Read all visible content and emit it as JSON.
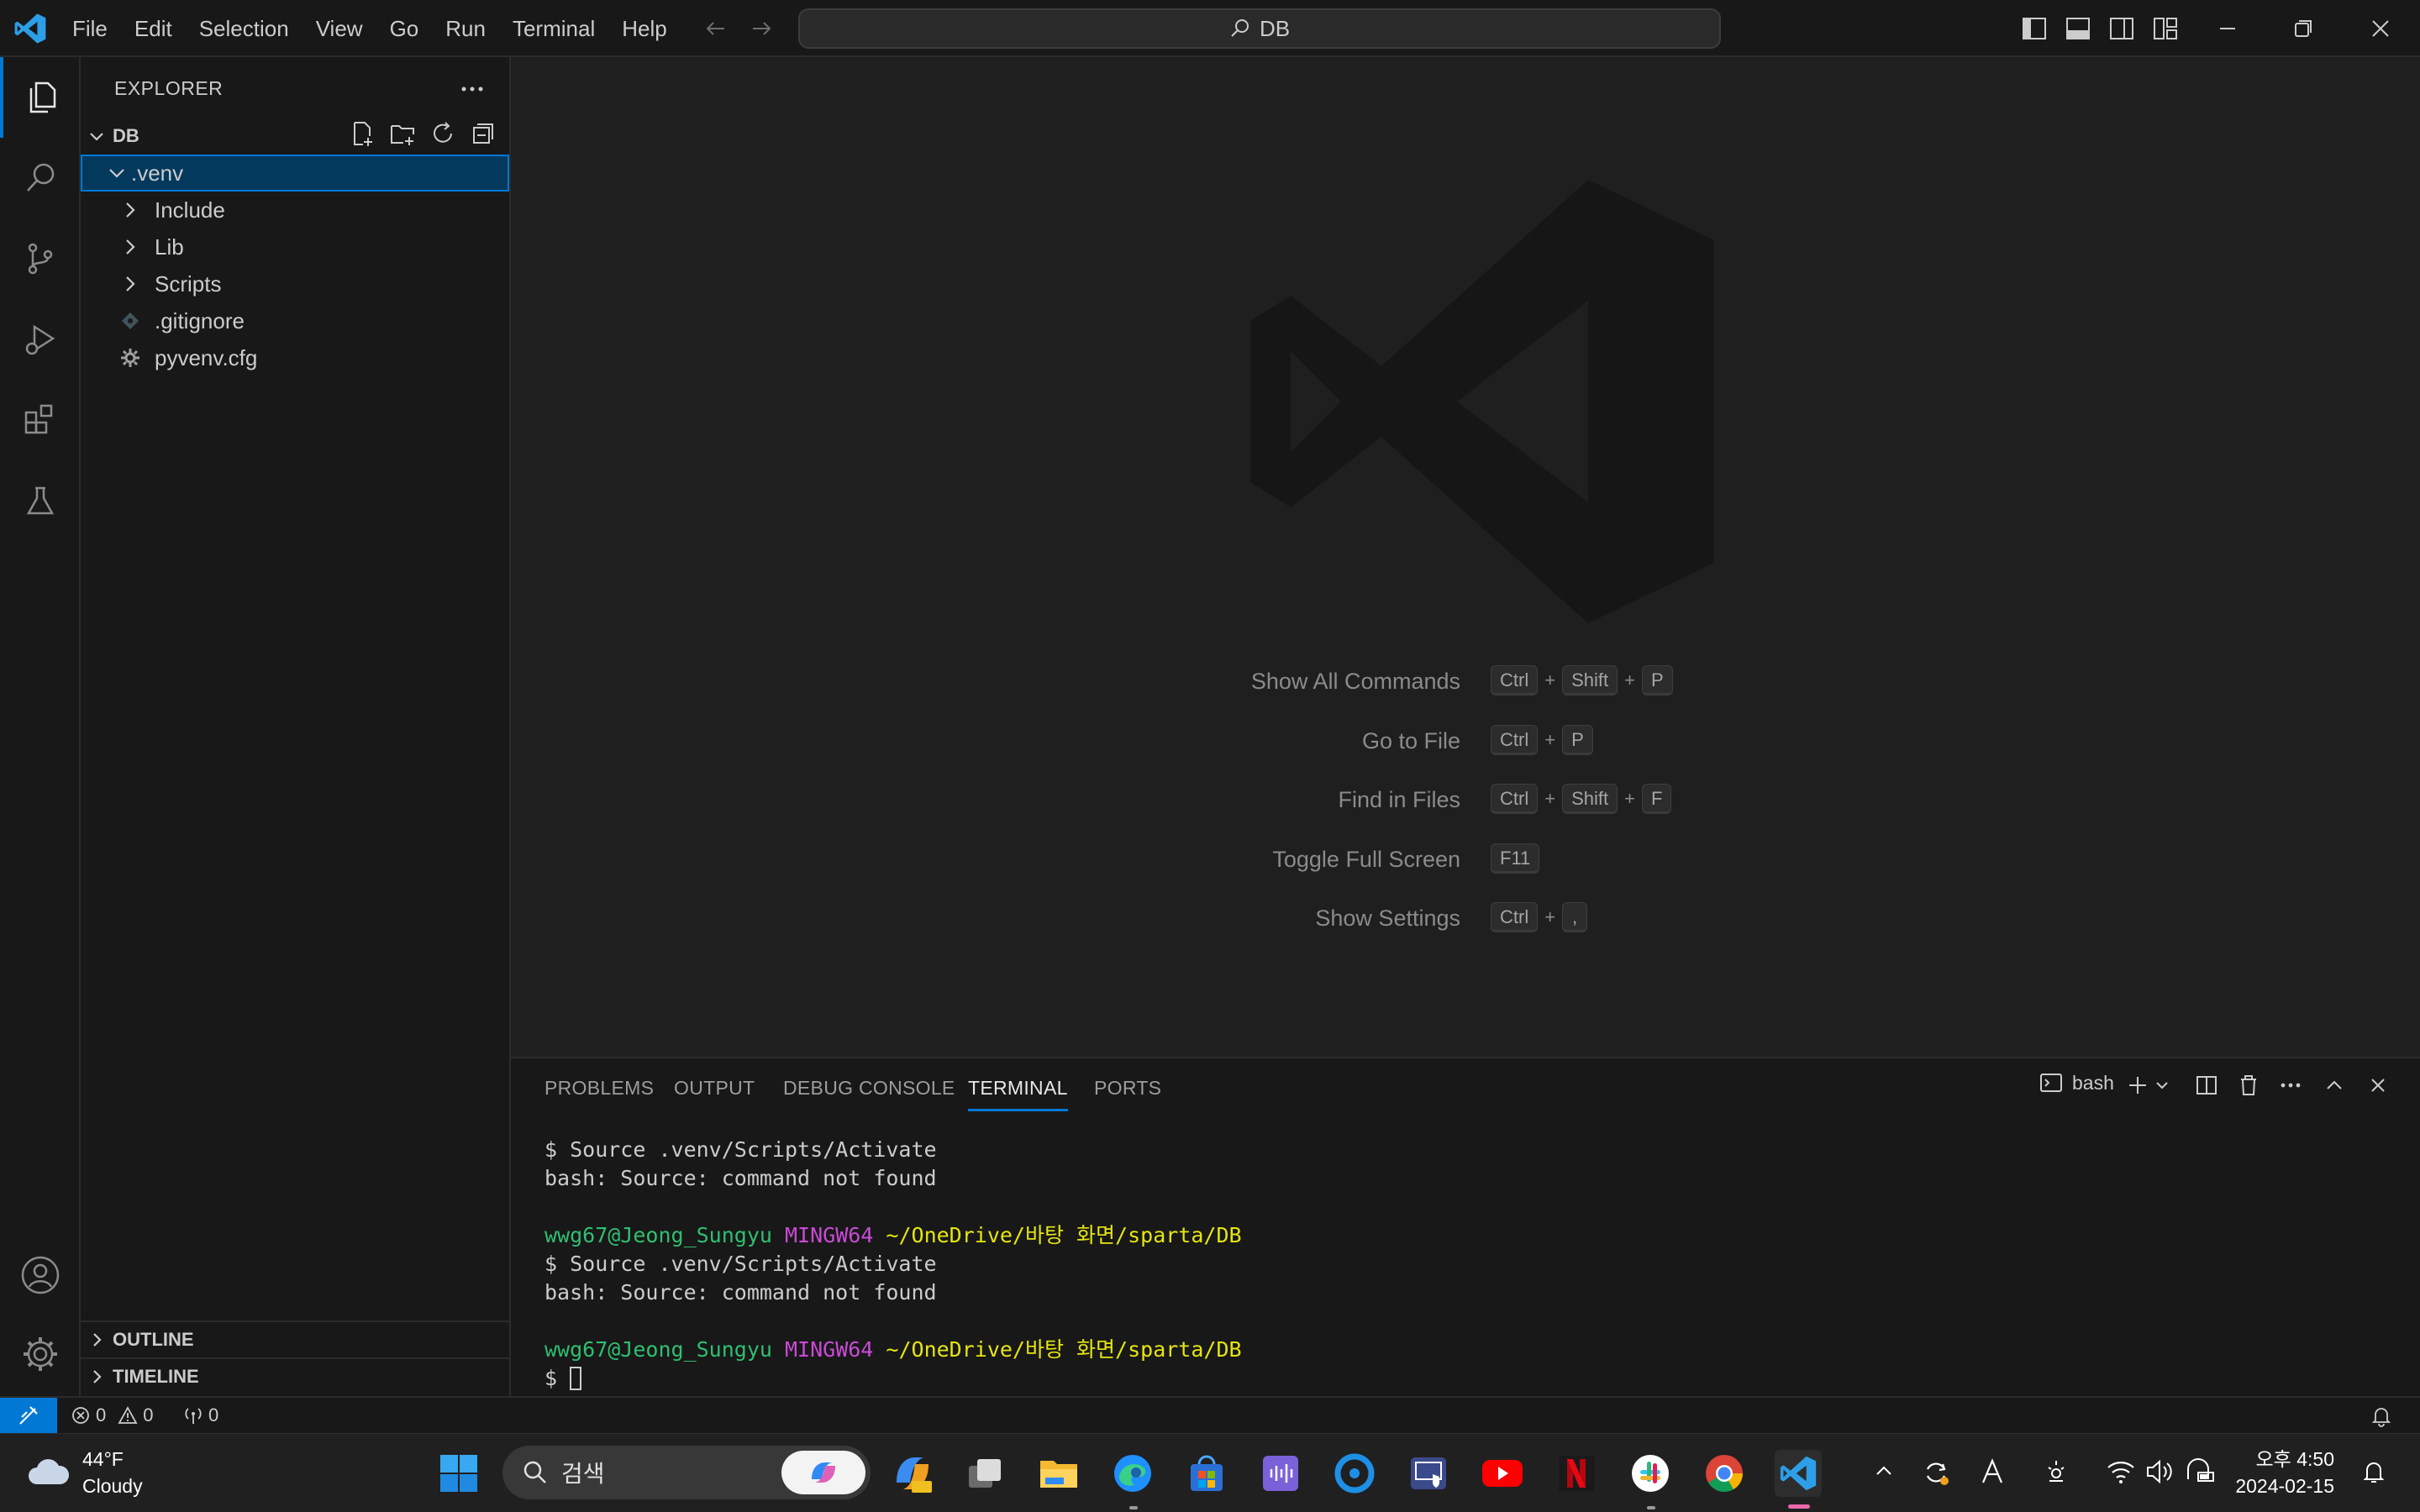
{
  "titlebar": {
    "menus": [
      "File",
      "Edit",
      "Selection",
      "View",
      "Go",
      "Run",
      "Terminal",
      "Help"
    ],
    "search_text": "DB"
  },
  "explorer": {
    "title": "EXPLORER",
    "folder": "DB",
    "tree": [
      {
        "label": ".venv",
        "type": "folder-open",
        "depth": 0,
        "selected": true
      },
      {
        "label": "Include",
        "type": "folder",
        "depth": 1
      },
      {
        "label": "Lib",
        "type": "folder",
        "depth": 1
      },
      {
        "label": "Scripts",
        "type": "folder",
        "depth": 1
      },
      {
        "label": ".gitignore",
        "type": "file-gitignore",
        "depth": 1
      },
      {
        "label": "pyvenv.cfg",
        "type": "file-cfg",
        "depth": 1
      }
    ],
    "outline": "OUTLINE",
    "timeline": "TIMELINE"
  },
  "welcome": {
    "shortcuts": [
      {
        "label": "Show All Commands",
        "keys": [
          "Ctrl",
          "Shift",
          "P"
        ]
      },
      {
        "label": "Go to File",
        "keys": [
          "Ctrl",
          "P"
        ]
      },
      {
        "label": "Find in Files",
        "keys": [
          "Ctrl",
          "Shift",
          "F"
        ]
      },
      {
        "label": "Toggle Full Screen",
        "keys": [
          "F11"
        ]
      },
      {
        "label": "Show Settings",
        "keys": [
          "Ctrl",
          ","
        ]
      }
    ]
  },
  "panel": {
    "tabs": [
      "PROBLEMS",
      "OUTPUT",
      "DEBUG CONSOLE",
      "TERMINAL",
      "PORTS"
    ],
    "active_tab": "TERMINAL",
    "shell": "bash",
    "lines": [
      {
        "kind": "cmd",
        "text": "$ Source .venv/Scripts/Activate"
      },
      {
        "kind": "out",
        "text": "bash: Source: command not found"
      },
      {
        "kind": "blank",
        "text": ""
      },
      {
        "kind": "prompt",
        "user": "wwg67@Jeong_Sungyu",
        "host": "MINGW64",
        "path": "~/OneDrive/바탕 화면/sparta/DB"
      },
      {
        "kind": "cmd",
        "text": "$ Source .venv/Scripts/Activate"
      },
      {
        "kind": "out",
        "text": "bash: Source: command not found"
      },
      {
        "kind": "blank",
        "text": ""
      },
      {
        "kind": "prompt",
        "user": "wwg67@Jeong_Sungyu",
        "host": "MINGW64",
        "path": "~/OneDrive/바탕 화면/sparta/DB"
      },
      {
        "kind": "input",
        "text": "$ "
      }
    ]
  },
  "statusbar": {
    "errors": "0",
    "warnings": "0",
    "ports": "0"
  },
  "taskbar": {
    "temp": "44°F",
    "condition": "Cloudy",
    "search_placeholder": "검색",
    "time": "오후 4:50",
    "date": "2024-02-15"
  },
  "colors": {
    "accent": "#0078d4",
    "prompt_user": "#2fbf71",
    "prompt_host": "#c94ad6",
    "prompt_path": "#e5e510"
  }
}
